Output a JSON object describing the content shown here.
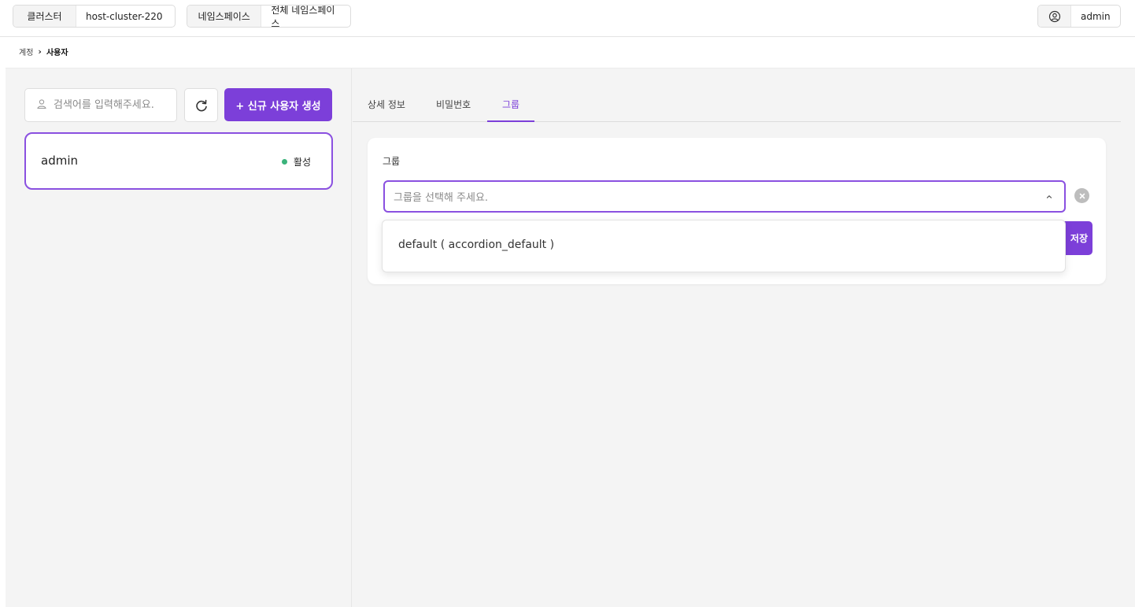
{
  "header": {
    "cluster_label": "클러스터",
    "cluster_value": "host-cluster-220",
    "namespace_label": "네임스페이스",
    "namespace_value": "전체 네임스페이스",
    "user_name": "admin"
  },
  "breadcrumb": {
    "parent": "계정",
    "separator": "›",
    "current": "사용자"
  },
  "sidebar": {
    "search_placeholder": "검색어를 입력해주세요.",
    "create_button": "+ 신규 사용자 생성",
    "users": [
      {
        "name": "admin",
        "status": "활성"
      }
    ]
  },
  "tabs": [
    {
      "label": "상세 정보",
      "active": false
    },
    {
      "label": "비밀번호",
      "active": false
    },
    {
      "label": "그룹",
      "active": true
    }
  ],
  "group_panel": {
    "label": "그룹",
    "select_placeholder": "그룹을 선택해 주세요.",
    "save_button": "저장",
    "options": [
      "default ( accordion_default )"
    ]
  },
  "colors": {
    "accent": "#7c3fd9",
    "active_status": "#3bb37b",
    "background": "#f4f4f4"
  },
  "icons": {
    "user": "user-circle-icon",
    "search": "person-icon",
    "refresh": "refresh-icon",
    "chevron": "chevron-up-icon",
    "clear": "clear-circle-icon"
  }
}
